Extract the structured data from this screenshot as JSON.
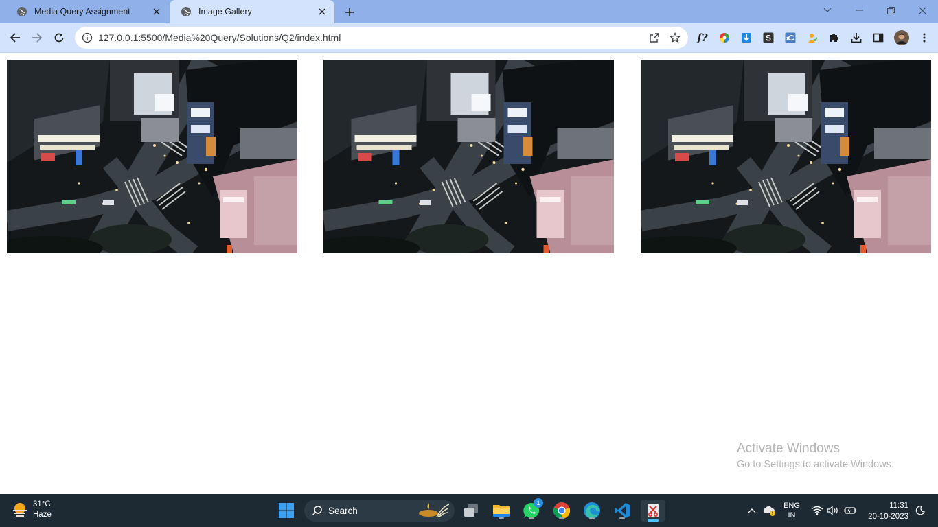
{
  "browser": {
    "tabs": [
      {
        "title": "Media Query Assignment"
      },
      {
        "title": "Image Gallery"
      }
    ],
    "url": "127.0.0.1:5500/Media%20Query/Solutions/Q2/index.html"
  },
  "gallery": {
    "images": [
      {
        "alt": "Aerial night view of city crossing"
      },
      {
        "alt": "Aerial night view of city crossing"
      },
      {
        "alt": "Aerial night view of city crossing"
      }
    ]
  },
  "watermark": {
    "line1": "Activate Windows",
    "line2": "Go to Settings to activate Windows."
  },
  "taskbar": {
    "weather_temp": "31°C",
    "weather_desc": "Haze",
    "search_label": "Search",
    "whatsapp_badge": "1",
    "lang_top": "ENG",
    "lang_bottom": "IN",
    "time": "11:31",
    "date": "20-10-2023"
  },
  "icons": {
    "windows": "windows-logo-icon",
    "files": "file-explorer-icon",
    "whatsapp": "whatsapp-icon",
    "chrome": "chrome-icon",
    "edge": "edge-icon",
    "vscode": "vscode-icon"
  }
}
